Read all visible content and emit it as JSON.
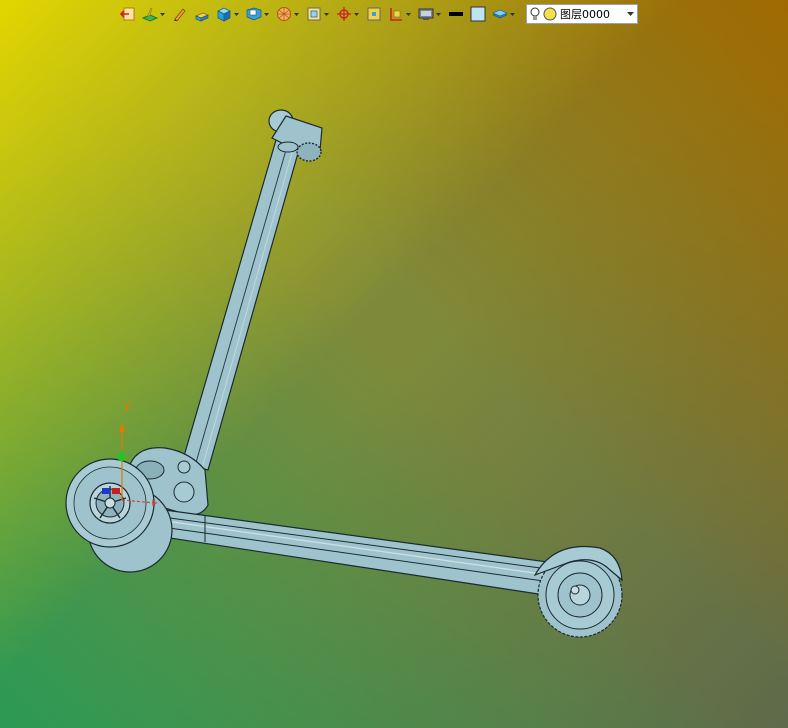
{
  "toolbar": {
    "tools": [
      {
        "icon": "exit-sketch-icon",
        "dropdown": false
      },
      {
        "icon": "sketch-plane-icon",
        "dropdown": true
      },
      {
        "icon": "pencil-icon",
        "dropdown": false
      },
      {
        "icon": "extrude-icon",
        "dropdown": false
      },
      {
        "icon": "solid-box-icon",
        "dropdown": true
      },
      {
        "icon": "feature-icon",
        "dropdown": true
      },
      {
        "icon": "render-sphere-icon",
        "dropdown": true
      },
      {
        "icon": "view-orient-icon",
        "dropdown": true
      },
      {
        "icon": "snap-point-icon",
        "dropdown": true
      },
      {
        "icon": "fit-view-icon",
        "dropdown": false
      },
      {
        "icon": "section-view-icon",
        "dropdown": true
      },
      {
        "icon": "display-mode-icon",
        "dropdown": true
      },
      {
        "icon": "line-weight-icon",
        "dropdown": false
      },
      {
        "icon": "color-swatch-icon",
        "dropdown": false
      },
      {
        "icon": "layer-manager-icon",
        "dropdown": true
      }
    ],
    "layer_select": {
      "value": "图层0000",
      "icons": [
        "lightbulb-icon",
        "layer-color-icon"
      ]
    }
  },
  "triad": {
    "y_label": "Y"
  },
  "colors": {
    "model_fill": "#9fc3cc",
    "model_edge": "#1a2a30",
    "triad_y": "#e07a00",
    "triad_z": "#23c423",
    "triad_x": "#d04040"
  }
}
